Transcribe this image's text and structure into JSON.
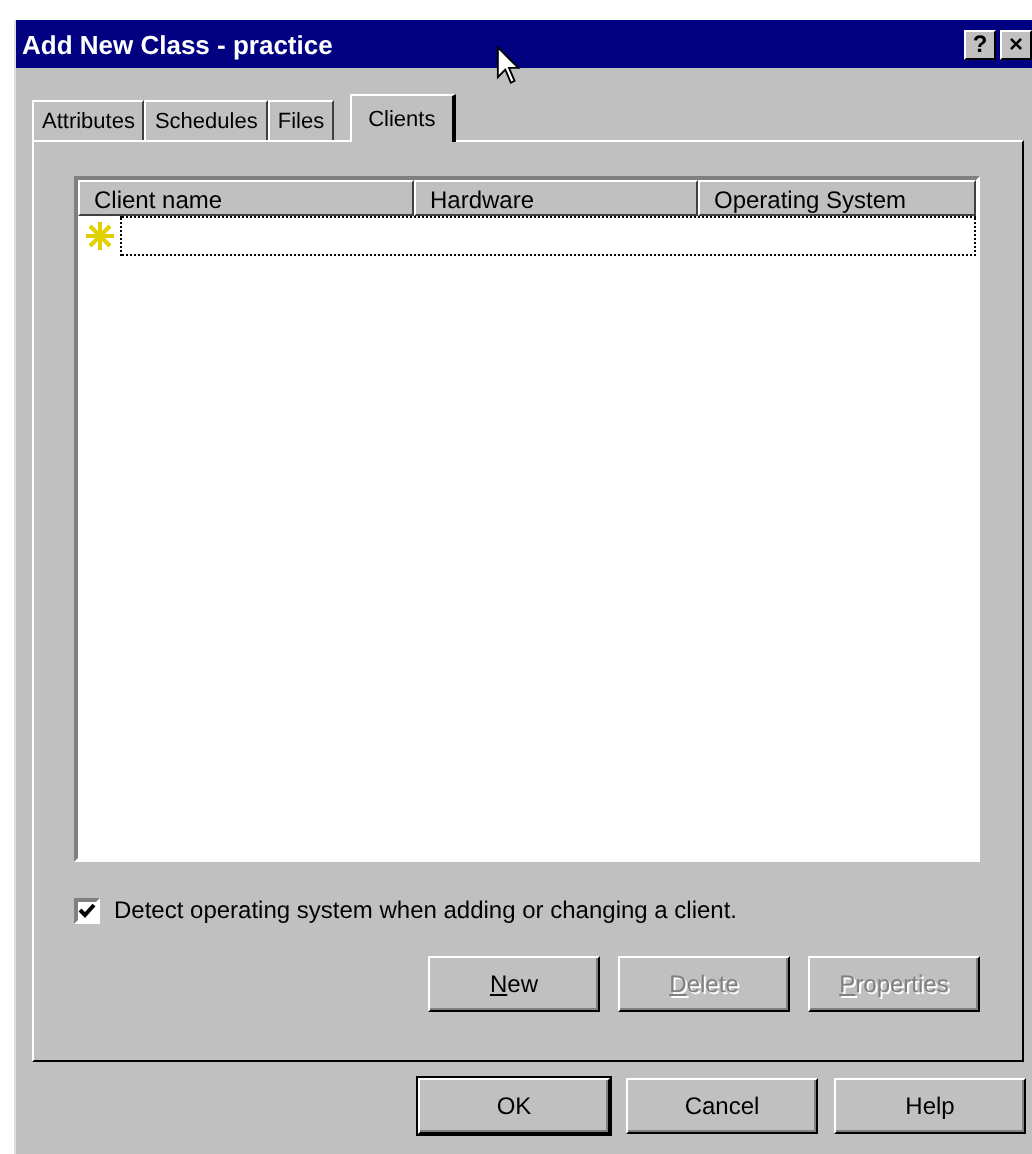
{
  "window": {
    "title": "Add New Class - practice",
    "title_buttons": [
      "?",
      "×"
    ]
  },
  "tabs": [
    {
      "label": "Attributes",
      "selected": false
    },
    {
      "label": "Schedules",
      "selected": false
    },
    {
      "label": "Files",
      "selected": false
    },
    {
      "label": "Clients",
      "selected": true
    }
  ],
  "table": {
    "columns": [
      "Client name",
      "Hardware",
      "Operating System"
    ],
    "rows": [
      {
        "kind": "new",
        "selected": true
      }
    ]
  },
  "checkbox": {
    "label": "Detect operating system when adding or changing a client.",
    "checked": true
  },
  "panel_buttons": [
    {
      "label": "New",
      "disabled": false
    },
    {
      "label": "Delete",
      "disabled": true
    },
    {
      "label": "Properties",
      "disabled": true
    }
  ],
  "dialog_buttons": [
    {
      "label": "OK",
      "default": true
    },
    {
      "label": "Cancel",
      "default": false
    },
    {
      "label": "Help",
      "default": false
    }
  ]
}
